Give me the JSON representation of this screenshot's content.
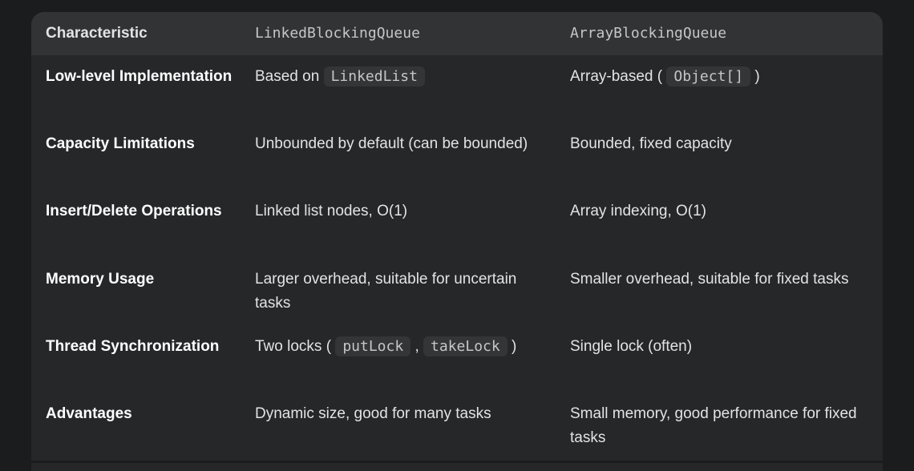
{
  "table": {
    "headers": [
      "Characteristic",
      "LinkedBlockingQueue",
      "ArrayBlockingQueue"
    ],
    "rows": [
      {
        "characteristic": "Low-level Implementation",
        "linked": {
          "pre": "Based on ",
          "code": "LinkedList",
          "post": ""
        },
        "array": {
          "pre": "Array-based (",
          "code": "Object[]",
          "post": ")"
        }
      },
      {
        "characteristic": "Capacity Limitations",
        "linked": {
          "pre": "Unbounded by default (can be bounded)"
        },
        "array": {
          "pre": "Bounded, fixed capacity"
        }
      },
      {
        "characteristic": "Insert/Delete Operations",
        "linked": {
          "pre": "Linked list nodes, O(1)"
        },
        "array": {
          "pre": "Array indexing, O(1)"
        }
      },
      {
        "characteristic": "Memory Usage",
        "linked": {
          "pre": "Larger overhead, suitable for uncertain tasks"
        },
        "array": {
          "pre": "Smaller overhead, suitable for fixed tasks"
        }
      },
      {
        "characteristic": "Thread Synchronization",
        "linked": {
          "pre": "Two locks (",
          "code1": "putLock",
          "mid": ",",
          "code2": "takeLock",
          "post": ")"
        },
        "array": {
          "pre": "Single lock (often)"
        }
      },
      {
        "characteristic": "Advantages",
        "linked": {
          "pre": "Dynamic size, good for many tasks"
        },
        "array": {
          "pre": "Small memory, good performance for fixed tasks"
        }
      }
    ]
  }
}
